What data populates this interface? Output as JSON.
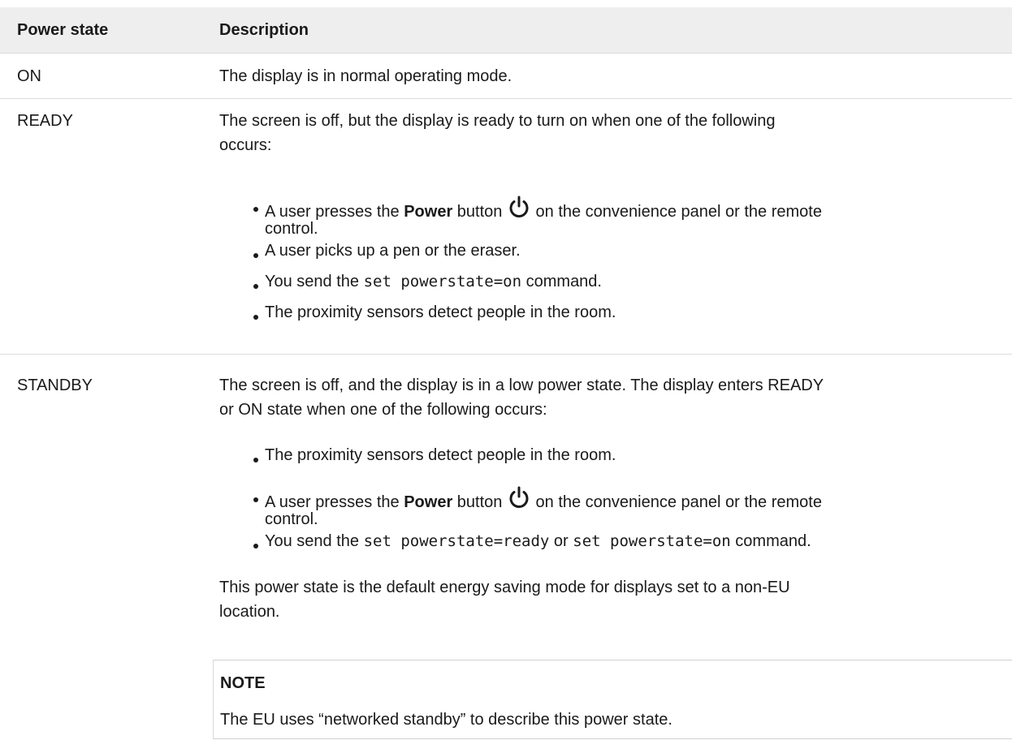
{
  "table": {
    "headers": {
      "state": "Power state",
      "description": "Description"
    },
    "rows": [
      {
        "state": "ON",
        "description": "The display is in normal operating mode."
      },
      {
        "state": "READY",
        "intro_line1": "The screen is off, but the display is ready to turn on when one of the following",
        "intro_line2": "occurs:",
        "bullets": {
          "b1_pre": "A user presses the ",
          "b1_bold": "Power",
          "b1_mid": " button ",
          "b1_post": " on the convenience panel or the remote",
          "b1_line2": "control.",
          "b2": "A user picks up a pen or the eraser.",
          "b3_pre": "You send the ",
          "b3_code": "set powerstate=on",
          "b3_post": " command.",
          "b4": "The proximity sensors detect people in the room."
        }
      },
      {
        "state": "STANDBY",
        "intro_line1": "The screen is off, and the display is in a low power state. The display enters READY",
        "intro_line2": "or ON state when one of the following occurs:",
        "bullets": {
          "b1": "The proximity sensors detect people in the room.",
          "b2_pre": "A user presses the ",
          "b2_bold": "Power",
          "b2_mid": " button ",
          "b2_post": " on the convenience panel or the remote",
          "b2_line2": "control.",
          "b3_pre": "You send the ",
          "b3_code1": "set powerstate=ready",
          "b3_mid": " or ",
          "b3_code2": "set powerstate=on",
          "b3_post": " command."
        },
        "para_line1": "This power state is the default energy saving mode for displays set to a non-EU",
        "para_line2": "location.",
        "note": {
          "title": "NOTE",
          "text": "The EU uses “networked standby” to describe this power state."
        }
      }
    ]
  },
  "icons": {
    "power": "power-icon"
  }
}
